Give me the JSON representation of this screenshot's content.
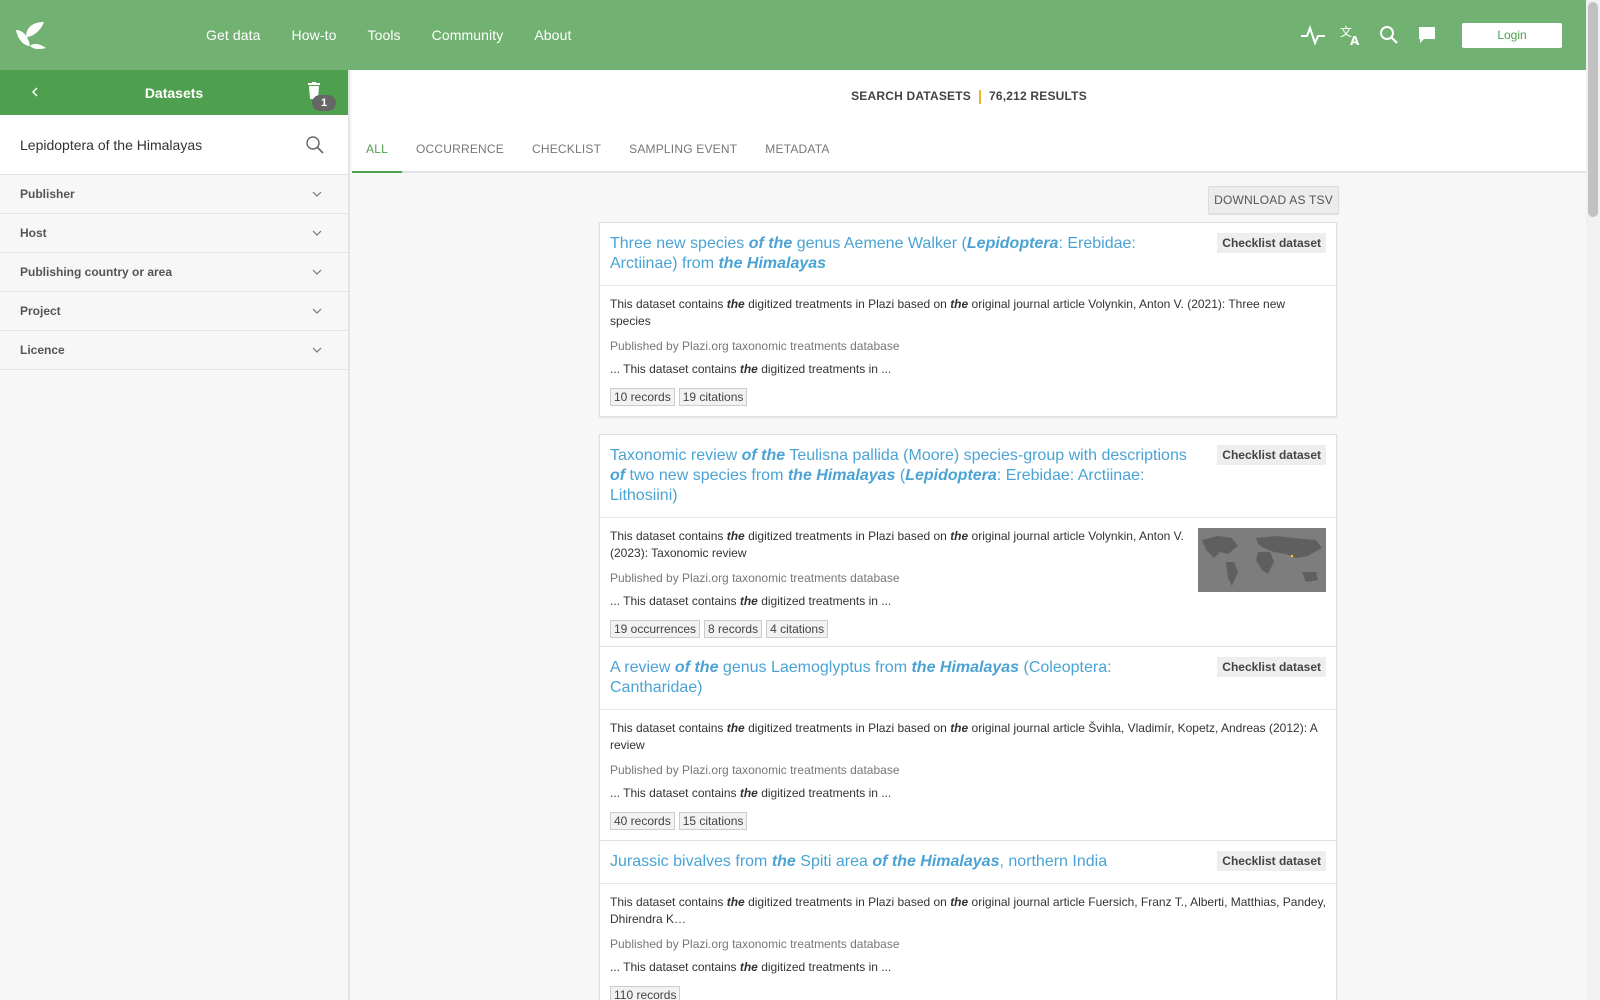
{
  "nav": {
    "items": [
      "Get data",
      "How-to",
      "Tools",
      "Community",
      "About"
    ],
    "login_label": "Login"
  },
  "icons": [
    "leaf-logo-icon",
    "activity-icon",
    "translate-icon",
    "search-icon",
    "feedback-icon"
  ],
  "colors": {
    "topbar": "#71b171",
    "sidebar_header": "#4ea04e",
    "link": "#4aa3d4",
    "accent": "#f0b429"
  },
  "sidebar": {
    "title": "Datasets",
    "badge": "1",
    "search_value": "Lepidoptera of the Himalayas",
    "facets": [
      "Publisher",
      "Host",
      "Publishing country or area",
      "Project",
      "Licence"
    ]
  },
  "main": {
    "search_label": "SEARCH DATASETS",
    "results": "76,212 RESULTS",
    "tabs": [
      "ALL",
      "OCCURRENCE",
      "CHECKLIST",
      "SAMPLING EVENT",
      "METADATA"
    ],
    "download_label": "DOWNLOAD AS TSV",
    "publisher_line": "Published by Plazi.org taxonomic treatments database",
    "snippet": {
      "pre": "... This dataset contains ",
      "em": "the",
      "post": " digitized treatments in ..."
    },
    "tag": "Checklist dataset",
    "cards": [
      {
        "title": [
          {
            "t": "Three new species ",
            "em": false
          },
          {
            "t": "of the",
            "em": true
          },
          {
            "t": " genus Aemene Walker (",
            "em": false
          },
          {
            "t": "Lepidoptera",
            "em": true
          },
          {
            "t": ": Erebidae: Arctiinae) from ",
            "em": false
          },
          {
            "t": "the Himalayas",
            "em": true
          }
        ],
        "desc": "Volynkin, Anton V. (2021): Three new species",
        "chips": [
          "10 records",
          "19 citations"
        ]
      },
      {
        "title": [
          {
            "t": "Taxonomic review ",
            "em": false
          },
          {
            "t": "of the",
            "em": true
          },
          {
            "t": " Teulisna pallida (Moore) species-group with descriptions ",
            "em": false
          },
          {
            "t": "of",
            "em": true
          },
          {
            "t": " two new species from ",
            "em": false
          },
          {
            "t": "the Himalayas",
            "em": true
          },
          {
            "t": " (",
            "em": false
          },
          {
            "t": "Lepidoptera",
            "em": true
          },
          {
            "t": ": Erebidae: Arctiinae: Lithosiini)",
            "em": false
          }
        ],
        "desc": "Volynkin, Anton V. (2023): Taxonomic review",
        "chips": [
          "19 occurrences",
          "8 records",
          "4 citations"
        ]
      },
      {
        "title": [
          {
            "t": "A review ",
            "em": false
          },
          {
            "t": "of the",
            "em": true
          },
          {
            "t": " genus Laemoglyptus from ",
            "em": false
          },
          {
            "t": "the Himalayas",
            "em": true
          },
          {
            "t": " (Coleoptera: Cantharidae)",
            "em": false
          }
        ],
        "desc": "Švihla, Vladimír, Kopetz, Andreas (2012): A review",
        "chips": [
          "40 records",
          "15 citations"
        ]
      },
      {
        "title": [
          {
            "t": "Jurassic bivalves from ",
            "em": false
          },
          {
            "t": "the",
            "em": true
          },
          {
            "t": " Spiti area ",
            "em": false
          },
          {
            "t": "of the Himalayas",
            "em": true
          },
          {
            "t": ", northern India",
            "em": false
          }
        ],
        "desc": "Fuersich, Franz T., Alberti, Matthias, Pandey, Dhirendra K…",
        "chips": [
          "110 records"
        ]
      }
    ]
  }
}
